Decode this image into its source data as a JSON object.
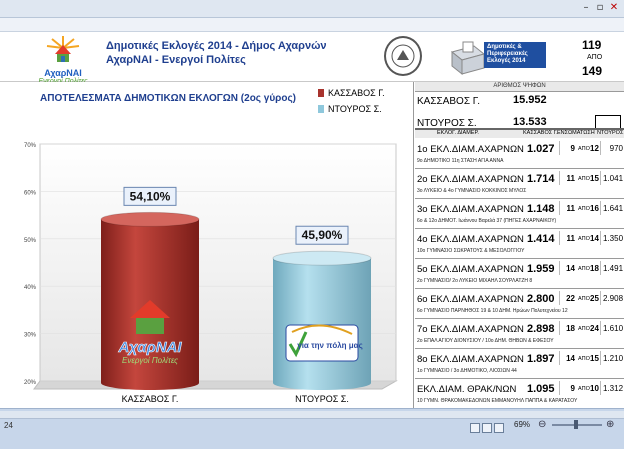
{
  "header": {
    "title_line1": "Δημοτικές Εκλογές 2014 - Δήμος Αχαρνών",
    "title_line2": "ΑχαρΝΑΙ - Ενεργοί Πολίτες",
    "logo_text_1": "ΑχαρΝΑΙ",
    "logo_text_2": "Ενεργοί Πολίτες",
    "badge_text": "Δημοτικές & Περιφερειακές Εκλογές 2014",
    "counted": "119",
    "apo_label": "ΑΠΟ",
    "total": "149"
  },
  "chart_data": {
    "type": "bar",
    "title": "ΑΠΟΤΕΛΕΣΜΑΤΑ ΔΗΜΟΤΙΚΩΝ ΕΚΛΟΓΩΝ (2ος γύρος)",
    "categories": [
      "ΚΑΣΣΑΒΟΣ Γ.",
      "ΝΤΟΥΡΟΣ Σ."
    ],
    "values": [
      54.1,
      45.9
    ],
    "data_labels": [
      "54,10%",
      "45,90%"
    ],
    "y_ticks": [
      "20%",
      "30%",
      "40%",
      "50%",
      "60%",
      "70%"
    ],
    "ylim": [
      20,
      70
    ],
    "legend": [
      "ΚΑΣΣΑΒΟΣ Γ.",
      "ΝΤΟΥΡΟΣ Σ."
    ],
    "colors": [
      "#a8332d",
      "#8fc8dc"
    ],
    "legend_position": "top-right"
  },
  "votes": {
    "header": "ΑΡΙΘΜΟΣ ΨΗΦΩΝ",
    "rows": [
      {
        "name": "ΚΑΣΣΑΒΟΣ Γ.",
        "value": "15.952"
      },
      {
        "name": "ΝΤΟΥΡΟΣ Σ.",
        "value": "13.533"
      }
    ]
  },
  "table": {
    "headers": [
      "ΕΚΛΟΓ. ΔΙΑΜΕΡ.",
      "ΚΑΣΣΑΒΟΣ Γ.",
      "ΕΝΣΩΜΑΤΩΣΗ",
      "ΝΤΟΥΡΟΣ"
    ],
    "apo": "ΑΠΟ",
    "rows": [
      {
        "name": "1ο ΕΚΛ.ΔΙΑΜ.ΑΧΑΡΝΩΝ",
        "kassavos": "1.027",
        "counted": "9",
        "total": "12",
        "ntouros": "970",
        "sub": "9ο ΔΗΜΟΤΙΚΟ 11η ΣΤΑΣΗ ΑΓΙΑ ΑΝΝΑ"
      },
      {
        "name": "2ο ΕΚΛ.ΔΙΑΜ.ΑΧΑΡΝΩΝ",
        "kassavos": "1.714",
        "counted": "11",
        "total": "15",
        "ntouros": "1.041",
        "sub": "3ο ΛΥΚΕΙΟ & 4ο ΓΥΜΝΑΣΙΟ ΚΟΚΚΙΝΟΣ ΜΥΛΟΣ"
      },
      {
        "name": "3ο ΕΚΛ.ΔΙΑΜ.ΑΧΑΡΝΩΝ",
        "kassavos": "1.148",
        "counted": "11",
        "total": "16",
        "ntouros": "1.641",
        "sub": "6ο & 12ο ΔΗΜΟΤ. Ιωάννου Βαρελά 37 (ΠΗΓΕΣ ΑΧΑΡΝΑΙΚΟΥ)"
      },
      {
        "name": "4ο ΕΚΛ.ΔΙΑΜ.ΑΧΑΡΝΩΝ",
        "kassavos": "1.414",
        "counted": "11",
        "total": "14",
        "ntouros": "1.350",
        "sub": "10ο ΓΥΜΝΑΣΙΟ ΣΩΚΡΑΤΟΥΣ & ΜΕΣΟΛΟΓΓΙΟΥ"
      },
      {
        "name": "5ο ΕΚΛ.ΔΙΑΜ.ΑΧΑΡΝΩΝ",
        "kassavos": "1.959",
        "counted": "14",
        "total": "18",
        "ntouros": "1.491",
        "sub": "2ο ΓΥΜΝΑΣΙΟ/ 2ο ΛΥΚΕΙΟ ΜΙΧΑΗΛ ΣΟΥΡΛΑΤΖΗ 8"
      },
      {
        "name": "6ο ΕΚΛ.ΔΙΑΜ.ΑΧΑΡΝΩΝ",
        "kassavos": "2.800",
        "counted": "22",
        "total": "25",
        "ntouros": "2.908",
        "sub": "6ο ΓΥΜΝΑΣΙΟ ΠΑΡΝΗΘΟΣ 19 & 10 ΔΗΜ. Ηρώων Πολυτεχνείου 12"
      },
      {
        "name": "7ο ΕΚΛ.ΔΙΑΜ.ΑΧΑΡΝΩΝ",
        "kassavos": "2.898",
        "counted": "18",
        "total": "24",
        "ntouros": "1.610",
        "sub": "2ο ΕΠΑΛ ΑΓΙΟΥ ΔΙΟΝΥΣΙΟΥ / 10ο ΔΗΜ. ΘΗΒΩΝ & ΕΦΕΣΟΥ"
      },
      {
        "name": "8ο ΕΚΛ.ΔΙΑΜ.ΑΧΑΡΝΩΝ",
        "kassavos": "1.897",
        "counted": "14",
        "total": "15",
        "ntouros": "1.210",
        "sub": "1ο ΓΥΜΝΑΣΙΟ / 3ο ΔΗΜΟΤΙΚΟ, ΛΙΟΣΙΩΝ 44"
      },
      {
        "name": "ΕΚΛ.ΔΙΑΜ. ΘΡΑΚ/ΝΩΝ",
        "kassavos": "1.095",
        "counted": "9",
        "total": "10",
        "ntouros": "1.312",
        "sub": "10 ΓΥΜΝ. ΘΡΑΚΟΜΑΚΕΔΟΝΩΝ ΕΜΜΑΝΟΥΗΛ ΠΑΠΠΑ & ΚΑΡΑΤΑΣΟΥ"
      }
    ]
  },
  "status": {
    "zoom": "69%",
    "sheet_num": "24"
  },
  "ntouros_logo_text": "για την πόλη μας"
}
